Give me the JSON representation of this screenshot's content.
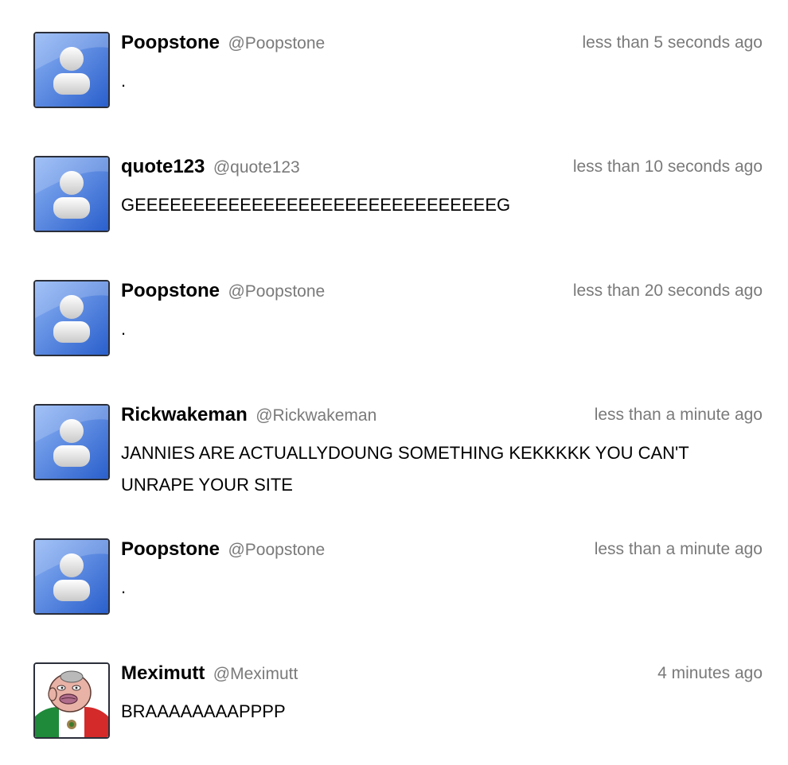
{
  "feed": {
    "posts": [
      {
        "display_name": "Poopstone",
        "handle": "@Poopstone",
        "timestamp": "less than 5 seconds ago",
        "text": ".",
        "avatar": "default-avatar"
      },
      {
        "display_name": "quote123",
        "handle": "@quote123",
        "timestamp": "less than 10 seconds ago",
        "text": "GEEEEEEEEEEEEEEEEEEEEEEEEEEEEEEEG",
        "avatar": "default-avatar"
      },
      {
        "display_name": "Poopstone",
        "handle": "@Poopstone",
        "timestamp": "less than 20 seconds ago",
        "text": ".",
        "avatar": "default-avatar"
      },
      {
        "display_name": "Rickwakeman",
        "handle": "@Rickwakeman",
        "timestamp": "less than a minute ago",
        "text": "JANNIES ARE ACTUALLYDOUNG SOMETHING KEKKKKK YOU CAN'T UNRAPE YOUR SITE",
        "avatar": "default-avatar"
      },
      {
        "display_name": "Poopstone",
        "handle": "@Poopstone",
        "timestamp": "less than a minute ago",
        "text": ".",
        "avatar": "default-avatar"
      },
      {
        "display_name": "Meximutt",
        "handle": "@Meximutt",
        "timestamp": "4 minutes ago",
        "text": "BRAAAAAAAAPPPP",
        "avatar": "custom-cartoon-avatar"
      }
    ]
  },
  "colors": {
    "avatar_blue_light": "#7aa6f0",
    "avatar_blue_dark": "#2e63cf",
    "meta_gray": "#7a7a7a",
    "flag_green": "#1e8a3a",
    "flag_red": "#d42a2a"
  }
}
